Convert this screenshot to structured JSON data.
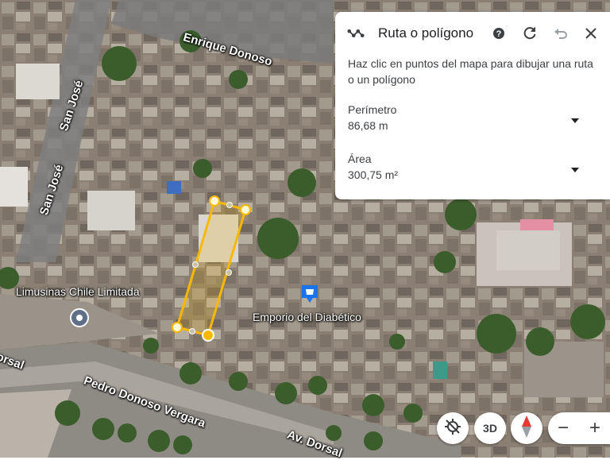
{
  "map": {
    "streets": {
      "enrique_donoso": "Enrique Donoso",
      "san_jose_1": "San José",
      "san_jose_2": "San José",
      "pedro_donoso_vergara": "Pedro Donoso Vergara",
      "av_dorsal": "Av. Dorsal",
      "dorsal_left": "orsal"
    },
    "places": {
      "limusinas": "Limusinas Chile Limitada",
      "emporio": "Emporio del Diabético"
    }
  },
  "panel": {
    "title": "Ruta o polígono",
    "description": "Haz clic en puntos del mapa para dibujar una ruta o un polígono",
    "perimeter_label": "Perímetro",
    "perimeter_value": "86,68 m",
    "area_label": "Área",
    "area_value": "300,75 m²"
  },
  "controls": {
    "view_3d": "3D",
    "zoom_out": "−",
    "zoom_in": "+"
  },
  "colors": {
    "polygon": "#f9b800",
    "poi_blue": "#1a73e8",
    "panel_icon": "#3c4043"
  },
  "icons": [
    "route-icon",
    "help-icon",
    "reset-icon",
    "undo-icon",
    "close-icon",
    "dropdown-icon",
    "location-pin-icon",
    "shopping-pin-icon",
    "tilt-icon",
    "compass-icon"
  ]
}
